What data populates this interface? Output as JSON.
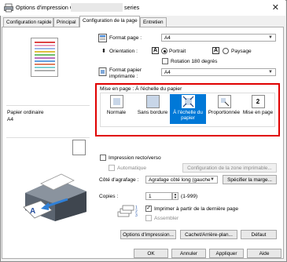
{
  "window": {
    "title_prefix": "Options d'impression Canon",
    "title_suffix": "series"
  },
  "tabs": [
    {
      "label": "Configuration rapide"
    },
    {
      "label": "Principal"
    },
    {
      "label": "Configuration de la page"
    },
    {
      "label": "Entretien"
    }
  ],
  "preview": {
    "media_type": "Papier ordinaire",
    "paper_size": "A4"
  },
  "page_size": {
    "label": "Format page :",
    "value": "A4"
  },
  "orientation": {
    "label": "Orientation :",
    "portrait": "Portrait",
    "landscape": "Paysage",
    "rotate": "Rotation 180 degrés"
  },
  "printer_paper": {
    "label_line1": "Format papier",
    "label_line2": "imprimante :",
    "value": "A4"
  },
  "layout": {
    "group_label": "Mise en page : À l'échelle du papier",
    "options": [
      {
        "label": "Normale",
        "icon": "normal-layout-icon"
      },
      {
        "label": "Sans bordure",
        "icon": "borderless-layout-icon"
      },
      {
        "label": "À l'échelle du papier",
        "icon": "fit-to-page-icon"
      },
      {
        "label": "Proportionnée",
        "icon": "scaled-layout-icon"
      },
      {
        "label": "Mise en page",
        "icon": "page-layout-icon",
        "badge": "2"
      }
    ],
    "selected_index": 2
  },
  "duplex": {
    "label": "Impression recto/verso",
    "auto_label": "Automatique",
    "print_area_button": "Configuration de la zone imprimable..."
  },
  "stapling": {
    "label": "Côté d'agrafage :",
    "value": "Agrafage côté long (gauche",
    "margin_button": "Spécifier la marge..."
  },
  "copies": {
    "label": "Copies :",
    "value": "1",
    "range": "(1-999)",
    "reverse_label": "Imprimer à partir de la dernière page",
    "collate_label": "Assembler"
  },
  "bottom_buttons": {
    "print_options": "Options d'impression...",
    "stamp_background": "Cachet/Arrière-plan...",
    "defaults": "Défaut"
  },
  "dialog_buttons": {
    "ok": "OK",
    "cancel": "Annuler",
    "apply": "Appliquer",
    "help": "Aide"
  },
  "colors": {
    "selected_bg": "#0078d7",
    "highlight_border": "#e00000"
  }
}
